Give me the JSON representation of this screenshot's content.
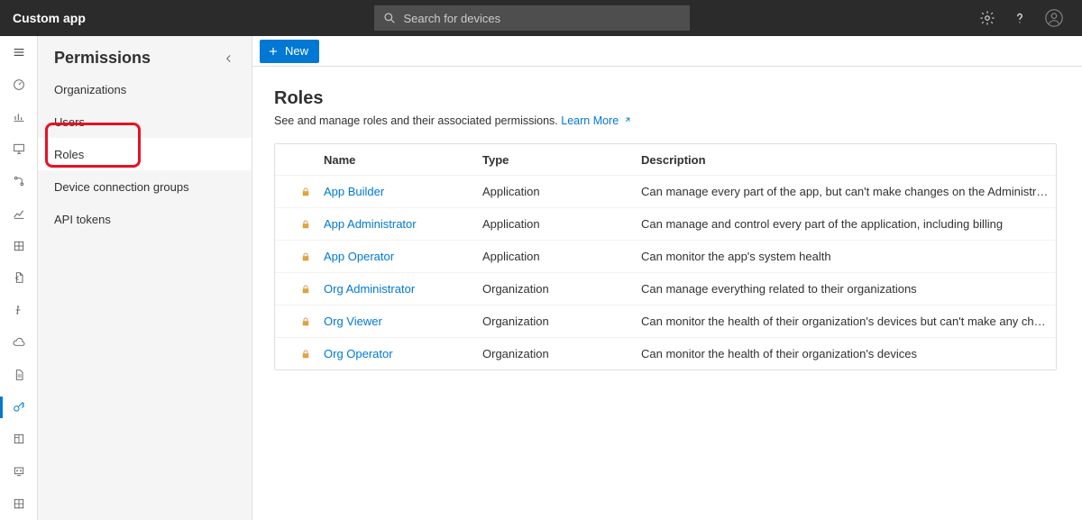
{
  "header": {
    "app_title": "Custom app",
    "search_placeholder": "Search for devices"
  },
  "panel": {
    "title": "Permissions",
    "items": [
      {
        "label": "Organizations",
        "active": false
      },
      {
        "label": "Users",
        "active": false
      },
      {
        "label": "Roles",
        "active": true
      },
      {
        "label": "Device connection groups",
        "active": false
      },
      {
        "label": "API tokens",
        "active": false
      }
    ]
  },
  "cmdbar": {
    "new_label": "New"
  },
  "page": {
    "title": "Roles",
    "subtitle": "See and manage roles and their associated permissions. ",
    "learn_more": "Learn More"
  },
  "table": {
    "columns": {
      "name": "Name",
      "type": "Type",
      "desc": "Description"
    },
    "rows": [
      {
        "name": "App Builder",
        "type": "Application",
        "desc": "Can manage every part of the app, but can't make changes on the Administration or Continuous Data Export pages"
      },
      {
        "name": "App Administrator",
        "type": "Application",
        "desc": "Can manage and control every part of the application, including billing"
      },
      {
        "name": "App Operator",
        "type": "Application",
        "desc": "Can monitor the app's system health"
      },
      {
        "name": "Org Administrator",
        "type": "Organization",
        "desc": "Can manage everything related to their organizations"
      },
      {
        "name": "Org Viewer",
        "type": "Organization",
        "desc": "Can monitor the health of their organization's devices but can't make any changes to them"
      },
      {
        "name": "Org Operator",
        "type": "Organization",
        "desc": "Can monitor the health of their organization's devices"
      }
    ]
  }
}
